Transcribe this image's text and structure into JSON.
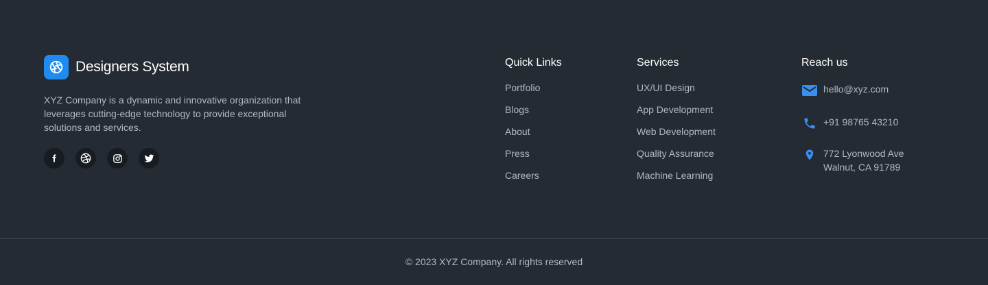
{
  "brand": {
    "name": "Designers System",
    "logo_icon": "aperture-icon",
    "logo_color": "#1f8bf0"
  },
  "description": "XYZ Company is a dynamic and innovative organization that leverages cutting-edge technology to provide exceptional solutions and services.",
  "socials": [
    {
      "icon": "facebook-icon"
    },
    {
      "icon": "dribbble-icon"
    },
    {
      "icon": "instagram-icon"
    },
    {
      "icon": "twitter-icon"
    }
  ],
  "quick_links": {
    "title": "Quick Links",
    "items": [
      "Portfolio",
      "Blogs",
      "About",
      "Press",
      "Careers"
    ]
  },
  "services": {
    "title": "Services",
    "items": [
      "UX/UI Design",
      "App Development",
      "Web Development",
      "Quality Assurance",
      "Machine Learning"
    ]
  },
  "reach_us": {
    "title": "Reach us",
    "email": "hello@xyz.com",
    "phone": "+91 98765 43210",
    "address_line1": "772 Lyonwood Ave",
    "address_line2": "Walnut, CA 91789",
    "icon_color": "#3b8ff0"
  },
  "copyright": "© 2023 XYZ Company. All rights reserved",
  "colors": {
    "background": "#252b33",
    "heading": "#ffffff",
    "text": "#b3b9c2",
    "accent": "#1f8bf0"
  }
}
